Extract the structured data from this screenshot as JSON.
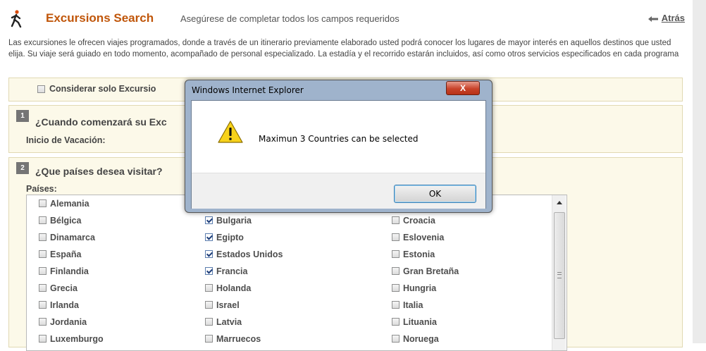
{
  "header": {
    "icon": "person-walking-icon",
    "title": "Excursions Search",
    "subtitle": "Asegúrese de completar todos los campos requeridos",
    "back_label": "Atrás",
    "back_icon": "arrow-left-icon"
  },
  "intro": "Las excursiones le ofrecen viajes programados, donde a través de un itinerario previamente elaborado usted podrá conocer los lugares de mayor interés en aquellos destinos que usted elija. Su viaje será guiado en todo momento, acompañado de personal especializado. La estadía y el recorrido estarán incluidos, así como otros servicios especificados en cada programa",
  "option_only": {
    "label": "Considerar solo Excursio",
    "checked": false
  },
  "step1": {
    "number": "1",
    "title": "¿Cuando comenzará su Exc",
    "field_label": "Inicio de Vacación:"
  },
  "step2": {
    "number": "2",
    "title": "¿Que países desea visitar?",
    "field_label": "Países:"
  },
  "countries": [
    {
      "name": "Alemania",
      "checked": false
    },
    {
      "name": "Bulgaria",
      "checked": true
    },
    {
      "name": "Bélgica",
      "checked": false
    },
    {
      "name": "Croacia",
      "checked": false
    },
    {
      "name": "Dinamarca",
      "checked": false
    },
    {
      "name": "Egipto",
      "checked": true
    },
    {
      "name": "Eslovenia",
      "checked": false
    },
    {
      "name": "España",
      "checked": false
    },
    {
      "name": "Estados Unidos",
      "checked": true
    },
    {
      "name": "Estonia",
      "checked": false
    },
    {
      "name": "Finlandia",
      "checked": false
    },
    {
      "name": "Francia",
      "checked": true
    },
    {
      "name": "Gran Bretaña",
      "checked": false
    },
    {
      "name": "Grecia",
      "checked": false
    },
    {
      "name": "Holanda",
      "checked": false
    },
    {
      "name": "Hungria",
      "checked": false
    },
    {
      "name": "Irlanda",
      "checked": false
    },
    {
      "name": "Israel",
      "checked": false
    },
    {
      "name": "Italia",
      "checked": false
    },
    {
      "name": "Jordania",
      "checked": false
    },
    {
      "name": "Latvia",
      "checked": false
    },
    {
      "name": "Lituania",
      "checked": false
    },
    {
      "name": "Luxemburgo",
      "checked": false
    },
    {
      "name": "Marruecos",
      "checked": false
    },
    {
      "name": "Noruega",
      "checked": false
    }
  ],
  "dialog": {
    "title": "Windows Internet Explorer",
    "close_label": "X",
    "icon": "warning-icon",
    "message": "Maximun 3 Countries can be selected",
    "ok_label": "OK"
  },
  "colors": {
    "title": "#c0560a",
    "panel_bg": "#fcf9e9",
    "panel_border": "#e1d9b3",
    "dialog_frame": "#9fb3cc"
  }
}
